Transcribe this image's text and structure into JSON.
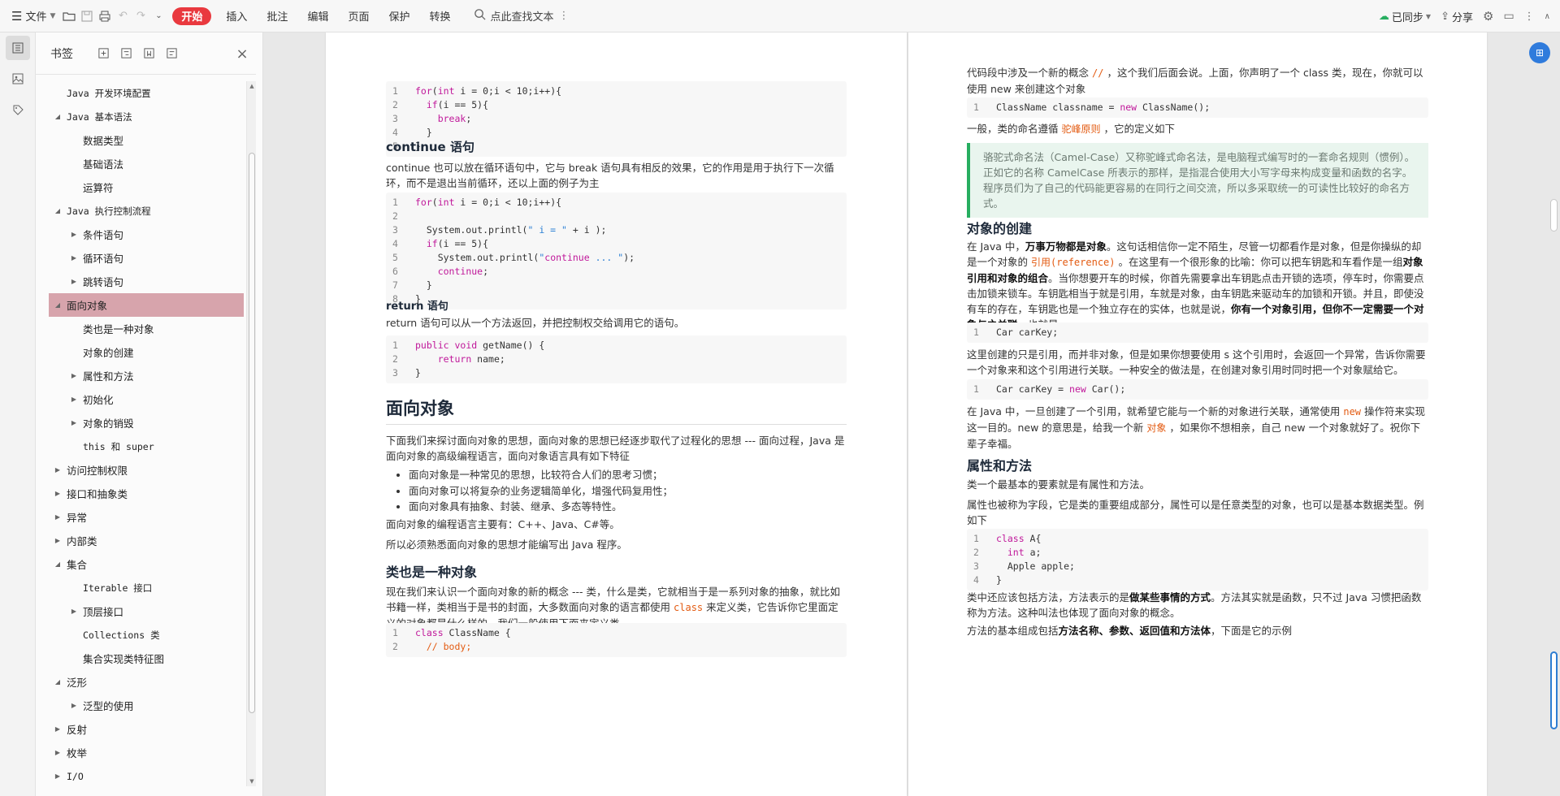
{
  "toolbar": {
    "file_label": "文件",
    "menus": [
      "开始",
      "插入",
      "批注",
      "编辑",
      "页面",
      "保护",
      "转换"
    ],
    "search_label": "点此查找文本",
    "sync_label": "已同步",
    "share_label": "分享"
  },
  "bookmarks": {
    "title": "书签",
    "items": [
      {
        "label": "Java 开发环境配置",
        "level": 1,
        "arrow": "none"
      },
      {
        "label": "Java 基本语法",
        "level": 1,
        "arrow": "down"
      },
      {
        "label": "数据类型",
        "level": 2,
        "arrow": "none"
      },
      {
        "label": "基础语法",
        "level": 2,
        "arrow": "none"
      },
      {
        "label": "运算符",
        "level": 2,
        "arrow": "none"
      },
      {
        "label": "Java 执行控制流程",
        "level": 1,
        "arrow": "down"
      },
      {
        "label": "条件语句",
        "level": 2,
        "arrow": "right"
      },
      {
        "label": "循环语句",
        "level": 2,
        "arrow": "right"
      },
      {
        "label": "跳转语句",
        "level": 2,
        "arrow": "right"
      },
      {
        "label": "面向对象",
        "level": 1,
        "arrow": "down",
        "active": true
      },
      {
        "label": "类也是一种对象",
        "level": 2,
        "arrow": "none"
      },
      {
        "label": "对象的创建",
        "level": 2,
        "arrow": "none"
      },
      {
        "label": "属性和方法",
        "level": 2,
        "arrow": "right"
      },
      {
        "label": "初始化",
        "level": 2,
        "arrow": "right"
      },
      {
        "label": "对象的销毁",
        "level": 2,
        "arrow": "right"
      },
      {
        "label": "this 和 super",
        "level": 2,
        "arrow": "none"
      },
      {
        "label": "访问控制权限",
        "level": 1,
        "arrow": "right"
      },
      {
        "label": "接口和抽象类",
        "level": 1,
        "arrow": "right"
      },
      {
        "label": "异常",
        "level": 1,
        "arrow": "right"
      },
      {
        "label": "内部类",
        "level": 1,
        "arrow": "right"
      },
      {
        "label": "集合",
        "level": 1,
        "arrow": "down"
      },
      {
        "label": "Iterable 接口",
        "level": 2,
        "arrow": "none"
      },
      {
        "label": "顶层接口",
        "level": 2,
        "arrow": "right"
      },
      {
        "label": "Collections 类",
        "level": 2,
        "arrow": "none"
      },
      {
        "label": "集合实现类特征图",
        "level": 2,
        "arrow": "none"
      },
      {
        "label": "泛形",
        "level": 1,
        "arrow": "down"
      },
      {
        "label": "泛型的使用",
        "level": 2,
        "arrow": "right"
      },
      {
        "label": "反射",
        "level": 1,
        "arrow": "right"
      },
      {
        "label": "枚举",
        "level": 1,
        "arrow": "right"
      },
      {
        "label": "I/O",
        "level": 1,
        "arrow": "right"
      }
    ]
  },
  "left_page": {
    "code1": [
      "for(int i = 0;i < 10;i++){",
      "  if(i == 5){",
      "    break;",
      "  }",
      "}"
    ],
    "continue_title": "continue 语句",
    "continue_text": "continue 也可以放在循环语句中，它与 break 语句具有相反的效果，它的作用是用于执行下一次循环，而不是退出当前循环，还以上面的例子为主",
    "code2": [
      "for(int i = 0;i < 10;i++){",
      "",
      "  System.out.printl(\" i = \" + i );",
      "  if(i == 5){",
      "    System.out.printl(\"continue ... \");",
      "    continue;",
      "  }",
      "}"
    ],
    "return_title": "return 语句",
    "return_text": "return 语句可以从一个方法返回，并把控制权交给调用它的语句。",
    "code3": [
      "public void getName() {",
      "    return name;",
      "}"
    ],
    "oo_title": "面向对象",
    "oo_text": "下面我们来探讨面向对象的思想，面向对象的思想已经逐步取代了过程化的思想 --- 面向过程，Java 是面向对象的高级编程语言，面向对象语言具有如下特征",
    "oo_bullets": [
      "面向对象是一种常见的思想，比较符合人们的思考习惯；",
      "面向对象可以将复杂的业务逻辑简单化，增强代码复用性；",
      "面向对象具有抽象、封装、继承、多态等特性。"
    ],
    "oo_langs": "面向对象的编程语言主要有：C++、Java、C#等。",
    "oo_must": "所以必须熟悉面向对象的思想才能编写出 Java 程序。",
    "class_title": "类也是一种对象",
    "class_text_a": "现在我们来认识一个面向对象的新的概念 --- 类，什么是类，它就相当于是一系列对象的抽象，就比如书籍一样，类相当于是书的封面，大多数面向对象的语言都使用",
    "class_kw": "class",
    "class_text_b": "来定义类，它告诉你它里面定义的对象都是什么样的，我们一般使用下面来定义类",
    "code4": [
      "class ClassName {",
      "  // body;"
    ]
  },
  "right_page": {
    "intro_a": "代码段中涉及一个新的概念",
    "intro_kw": "//",
    "intro_b": "，这个我们后面会说。上面，你声明了一个 class 类，现在，你就可以使用 new 来创建这个对象",
    "code1": [
      "ClassName classname = new ClassName();"
    ],
    "naming_a": "一般，类的命名遵循",
    "naming_kw": "驼峰原则",
    "naming_b": "，它的定义如下",
    "quote": "骆驼式命名法（Camel-Case）又称驼峰式命名法，是电脑程式编写时的一套命名规则（惯例）。正如它的名称 CamelCase 所表示的那样，是指混合使用大小写字母来构成变量和函数的名字。程序员们为了自己的代码能更容易的在同行之间交流，所以多采取统一的可读性比较好的命名方式。",
    "create_title": "对象的创建",
    "create_p1_a": "在 Java 中，",
    "create_p1_b": "万事万物都是对象",
    "create_p1_c": "。这句话相信你一定不陌生，尽管一切都看作是对象，但是你操纵的却是一个对象的",
    "create_p1_kw": "引用(reference)",
    "create_p1_d": "。在这里有一个很形象的比喻：你可以把车钥匙和车看作是一组",
    "create_p1_e": "对象引用和对象的组合",
    "create_p1_f": "。当你想要开车的时候，你首先需要拿出车钥匙点击开锁的选项，停车时，你需要点击加锁来锁车。车钥匙相当于就是引用，车就是对象，由车钥匙来驱动车的加锁和开锁。并且，即使没有车的存在，车钥匙也是一个独立存在的实体，也就是说，",
    "create_p1_g": "你有一个对象引用，但你不一定需要一个对象与之关联",
    "create_p1_h": "，也就是",
    "code2": [
      "Car carKey;"
    ],
    "create_p2": "这里创建的只是引用，而并非对象，但是如果你想要使用 s 这个引用时，会返回一个异常，告诉你需要一个对象来和这个引用进行关联。一种安全的做法是，在创建对象引用时同时把一个对象赋给它。",
    "code3": [
      "Car carKey = new Car();"
    ],
    "create_p3_a": "在 Java 中，一旦创建了一个引用，就希望它能与一个新的对象进行关联，通常使用",
    "create_p3_kw1": "new",
    "create_p3_b": "操作符来实现这一目的。new 的意思是，给我一个新",
    "create_p3_kw2": "对象",
    "create_p3_c": "，如果你不想相亲，自己 new 一个对象就好了。祝你下辈子幸福。",
    "attr_title": "属性和方法",
    "attr_p1": "类一个最基本的要素就是有属性和方法。",
    "attr_p2": "属性也被称为字段，它是类的重要组成部分，属性可以是任意类型的对象，也可以是基本数据类型。例如下",
    "code4": [
      "class A{",
      "  int a;",
      "  Apple apple;",
      "}"
    ],
    "attr_p3_a": "类中还应该包括方法，方法表示的是",
    "attr_p3_b": "做某些事情的方式",
    "attr_p3_c": "。方法其实就是函数，只不过 Java 习惯把函数称为方法。这种叫法也体现了面向对象的概念。",
    "attr_p4_a": "方法的基本组成包括",
    "attr_p4_b": "方法名称、参数、返回值和方法体",
    "attr_p4_c": "，下面是它的示例"
  },
  "colors": {
    "accent": "#e9393f",
    "active_bookmark": "#d7a4ac",
    "code_keyword": "#e35b12",
    "quote_border": "#27ae60"
  }
}
